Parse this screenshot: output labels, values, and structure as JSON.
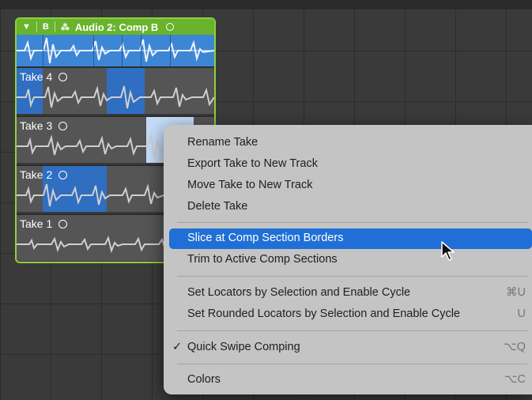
{
  "colors": {
    "comp_header": "#69b32d",
    "comp_border": "#8ed13a",
    "region_blue": "#3d86d6",
    "selection_blue": "#2f6ec1",
    "menu_bg": "#c4c4c4",
    "menu_highlight": "#1f6fd6"
  },
  "take_folder": {
    "collapse_glyph": "▼",
    "b_label": "B",
    "flex_icon": "⁂",
    "title": "Audio 2: Comp B",
    "takes": [
      {
        "label": "Take 4"
      },
      {
        "label": "Take 3"
      },
      {
        "label": "Take 2"
      },
      {
        "label": "Take 1"
      }
    ]
  },
  "menu": {
    "items": [
      {
        "label": "Rename Take"
      },
      {
        "label": "Export Take to New Track"
      },
      {
        "label": "Move Take to New Track"
      },
      {
        "label": "Delete Take"
      },
      {
        "label": "Slice at Comp Section Borders",
        "highlighted": true
      },
      {
        "label": "Trim to Active Comp Sections"
      },
      {
        "label": "Set Locators by Selection and Enable Cycle",
        "shortcut": "⌘U"
      },
      {
        "label": "Set Rounded Locators by Selection and Enable Cycle",
        "shortcut": "U"
      },
      {
        "label": "Quick Swipe Comping",
        "checked": true,
        "check_glyph": "✓",
        "shortcut": "⌥Q"
      },
      {
        "label": "Colors",
        "shortcut": "⌥C"
      }
    ]
  }
}
